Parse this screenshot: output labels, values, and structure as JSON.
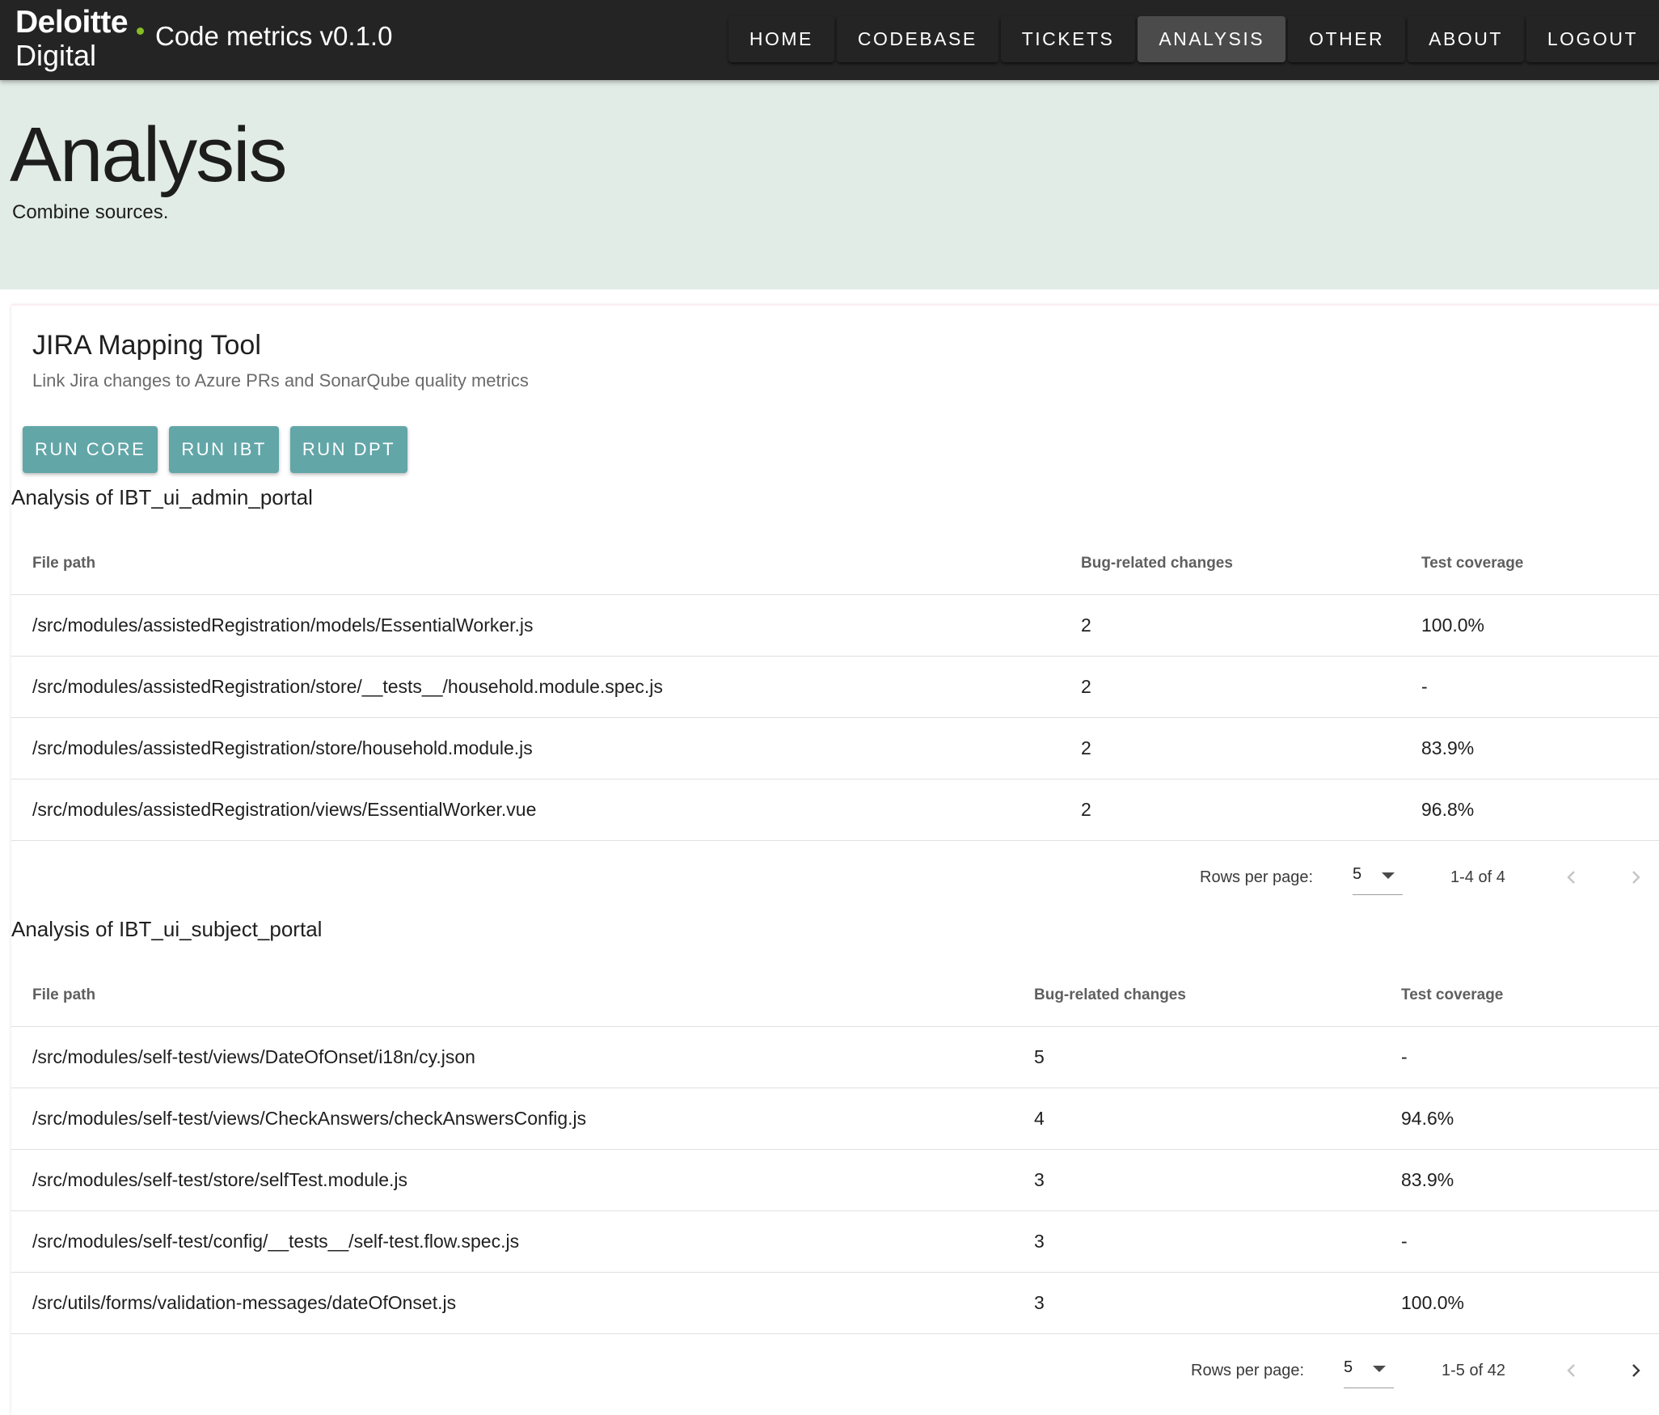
{
  "header": {
    "logo_top": "Deloitte",
    "logo_bottom": "Digital",
    "app_title": "Code metrics v0.1.0",
    "nav": [
      "HOME",
      "CODEBASE",
      "TICKETS",
      "ANALYSIS",
      "OTHER",
      "ABOUT",
      "LOGOUT"
    ],
    "active_nav": "ANALYSIS"
  },
  "hero": {
    "title": "Analysis",
    "subtitle": "Combine sources."
  },
  "card": {
    "title": "JIRA Mapping Tool",
    "subtitle": "Link Jira changes to Azure PRs and SonarQube quality metrics",
    "buttons": [
      "RUN CORE",
      "RUN IBT",
      "RUN DPT"
    ]
  },
  "sections": [
    {
      "title": "Analysis of IBT_ui_admin_portal",
      "headers": [
        "File path",
        "Bug-related changes",
        "Test coverage"
      ],
      "rows": [
        [
          "/src/modules/assistedRegistration/models/EssentialWorker.js",
          "2",
          "100.0%"
        ],
        [
          "/src/modules/assistedRegistration/store/__tests__/household.module.spec.js",
          "2",
          "-"
        ],
        [
          "/src/modules/assistedRegistration/store/household.module.js",
          "2",
          "83.9%"
        ],
        [
          "/src/modules/assistedRegistration/views/EssentialWorker.vue",
          "2",
          "96.8%"
        ]
      ],
      "rows_per_page_label": "Rows per page:",
      "rows_per_page": "5",
      "page_range": "1-4 of 4"
    },
    {
      "title": "Analysis of IBT_ui_subject_portal",
      "headers": [
        "File path",
        "Bug-related changes",
        "Test coverage"
      ],
      "rows": [
        [
          "/src/modules/self-test/views/DateOfOnset/i18n/cy.json",
          "5",
          "-"
        ],
        [
          "/src/modules/self-test/views/CheckAnswers/checkAnswersConfig.js",
          "4",
          "94.6%"
        ],
        [
          "/src/modules/self-test/store/selfTest.module.js",
          "3",
          "83.9%"
        ],
        [
          "/src/modules/self-test/config/__tests__/self-test.flow.spec.js",
          "3",
          "-"
        ],
        [
          "/src/utils/forms/validation-messages/dateOfOnset.js",
          "3",
          "100.0%"
        ]
      ],
      "rows_per_page_label": "Rows per page:",
      "rows_per_page": "5",
      "page_range": "1-5 of 42"
    }
  ],
  "colors": {
    "appbar": "#242424",
    "hero_bg": "#e2ece7",
    "button_teal": "#62a6a8",
    "brand_dot": "#86bc25"
  }
}
